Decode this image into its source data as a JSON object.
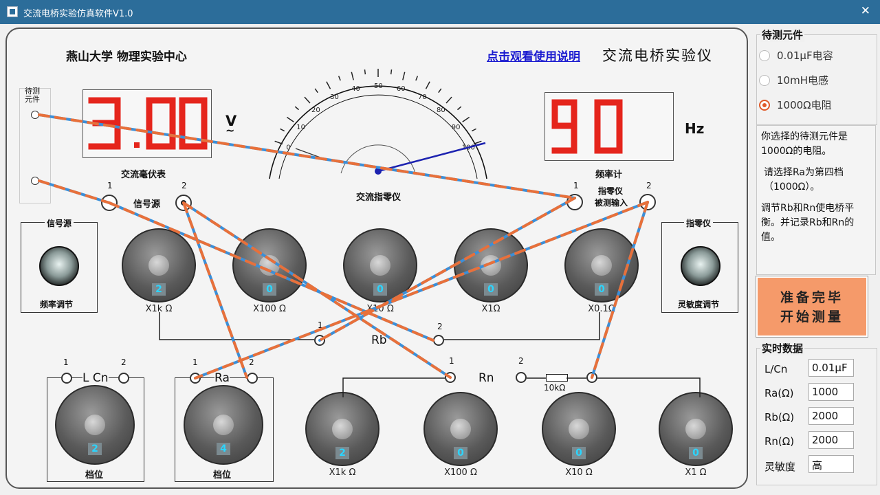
{
  "window": {
    "title": "交流电桥实验仿真软件V1.0",
    "close_label": "✕"
  },
  "header": {
    "org": "燕山大学 物理实验中心",
    "help_link": "点击观看使用说明",
    "instrument_title": "交流电桥实验仪"
  },
  "left_terminals": {
    "label_line1": "待测",
    "label_line2": "元件"
  },
  "voltmeter": {
    "reading": "3.00",
    "unit": "V",
    "unit_symbol": "~",
    "label": "交流毫伏表"
  },
  "freq_meter": {
    "reading": "90",
    "unit": "Hz",
    "label": "频率计"
  },
  "null_gauge": {
    "label": "交流指零仪",
    "ticks": [
      "0",
      "10",
      "20",
      "30",
      "40",
      "50",
      "60",
      "70",
      "80",
      "90",
      "100"
    ]
  },
  "signal_source": {
    "label": "信号源",
    "t1": "1",
    "t2": "2",
    "box_title": "信号源",
    "knob_label": "频率调节"
  },
  "null_input": {
    "label_line1": "指零仪",
    "label_line2": "被测输入",
    "t1": "1",
    "t2": "2",
    "box_title": "指零仪",
    "knob_label": "灵敏度调节"
  },
  "rb_knobs": [
    {
      "value": "2",
      "label": "X1k Ω"
    },
    {
      "value": "0",
      "label": "X100 Ω"
    },
    {
      "value": "0",
      "label": "X10 Ω"
    },
    {
      "value": "0",
      "label": "X1Ω"
    },
    {
      "value": "0",
      "label": "X0.1Ω"
    }
  ],
  "rb_bus": {
    "label": "Rb",
    "t1": "1",
    "t2": "2"
  },
  "lcn": {
    "label": "L Cn",
    "t1": "1",
    "t2": "2",
    "value": "2",
    "knob_label": "档位"
  },
  "ra": {
    "label": "Ra",
    "t1": "1",
    "t2": "2",
    "value": "4",
    "knob_label": "档位"
  },
  "rn": {
    "label": "Rn",
    "t1": "1",
    "t2": "2",
    "resistor": "10kΩ"
  },
  "rn_knobs": [
    {
      "value": "2",
      "label": "X1k Ω"
    },
    {
      "value": "0",
      "label": "X100 Ω"
    },
    {
      "value": "0",
      "label": "X10 Ω"
    },
    {
      "value": "0",
      "label": "X1 Ω"
    }
  ],
  "side": {
    "group_title": "待测元件",
    "options": [
      {
        "label": "0.01μF电容",
        "selected": false
      },
      {
        "label": "10mH电感",
        "selected": false
      },
      {
        "label": "1000Ω电阻",
        "selected": true
      }
    ],
    "info_p1": "你选择的待测元件是1000Ω的电阻。",
    "info_p2": "请选择Ra为第四档（1000Ω）。",
    "info_p3": "调节Rb和Rn使电桥平衡。并记录Rb和Rn的值。",
    "start_line1": "准备完毕",
    "start_line2": "开始测量",
    "rt_title": "实时数据",
    "rows": [
      {
        "label": "L/Cn",
        "value": "0.01μF"
      },
      {
        "label": "Ra(Ω)",
        "value": "1000"
      },
      {
        "label": "Rb(Ω)",
        "value": "2000"
      },
      {
        "label": "Rn(Ω)",
        "value": "2000"
      },
      {
        "label": "灵敏度",
        "value": "高"
      }
    ]
  }
}
